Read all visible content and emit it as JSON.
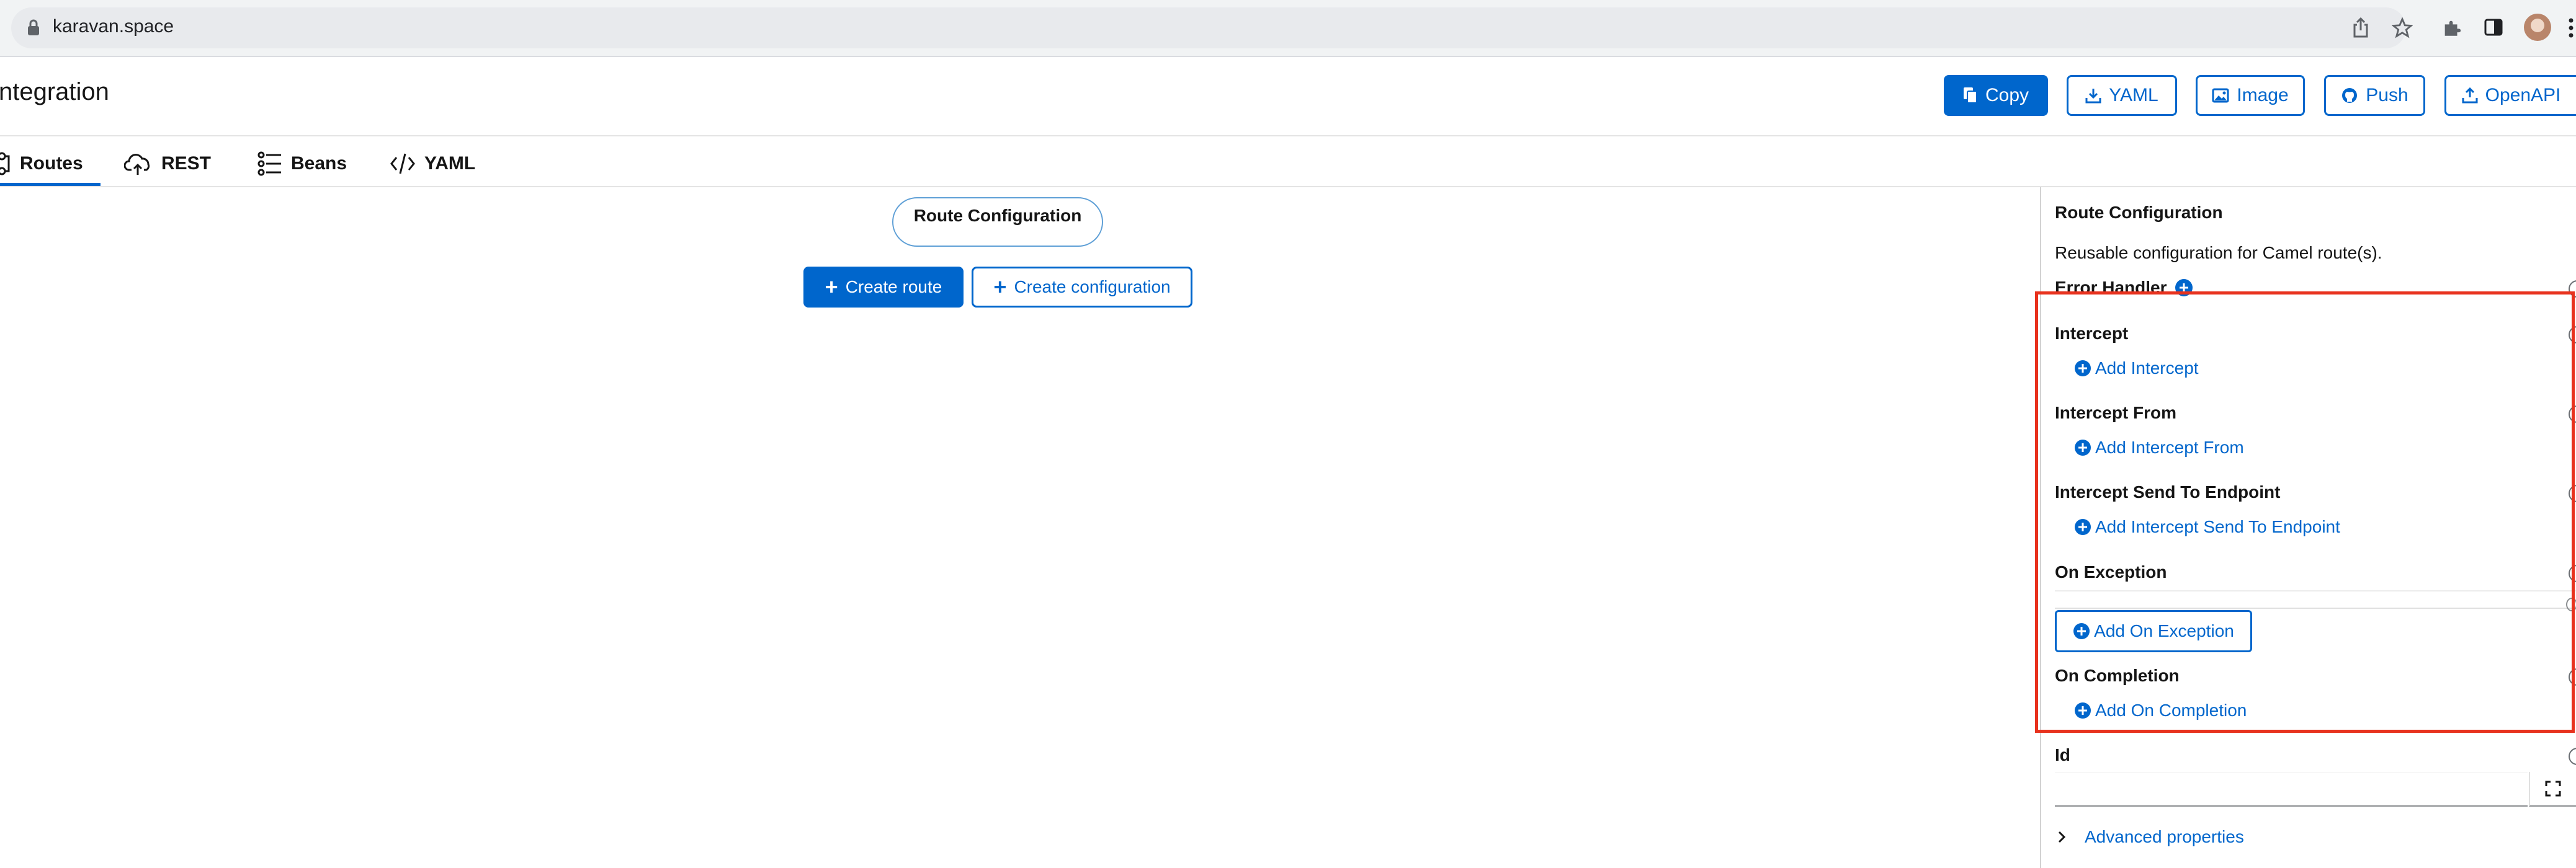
{
  "browser": {
    "url": "karavan.space"
  },
  "header": {
    "title": "ntegration",
    "buttons": {
      "copy": "Copy",
      "yaml": "YAML",
      "image": "Image",
      "push": "Push",
      "openapi": "OpenAPI"
    }
  },
  "tabs": [
    {
      "label": "Routes"
    },
    {
      "label": "REST"
    },
    {
      "label": "Beans"
    },
    {
      "label": "YAML"
    }
  ],
  "canvas": {
    "node_label": "Route Configuration",
    "create_route": "Create route",
    "create_configuration": "Create configuration"
  },
  "properties": {
    "title": "Route Configuration",
    "description": "Reusable configuration for Camel route(s).",
    "error_handler": "Error Handler",
    "sections": [
      {
        "label": "Intercept",
        "add": "Add Intercept"
      },
      {
        "label": "Intercept From",
        "add": "Add Intercept From"
      },
      {
        "label": "Intercept Send To Endpoint",
        "add": "Add Intercept Send To Endpoint"
      },
      {
        "label": "On Exception",
        "add": "Add On Exception"
      },
      {
        "label": "On Completion",
        "add": "Add On Completion"
      }
    ],
    "id_label": "Id",
    "id_value": "",
    "advanced": "Advanced properties"
  },
  "colors": {
    "accent": "#0066cc",
    "highlight": "#e8321e"
  }
}
